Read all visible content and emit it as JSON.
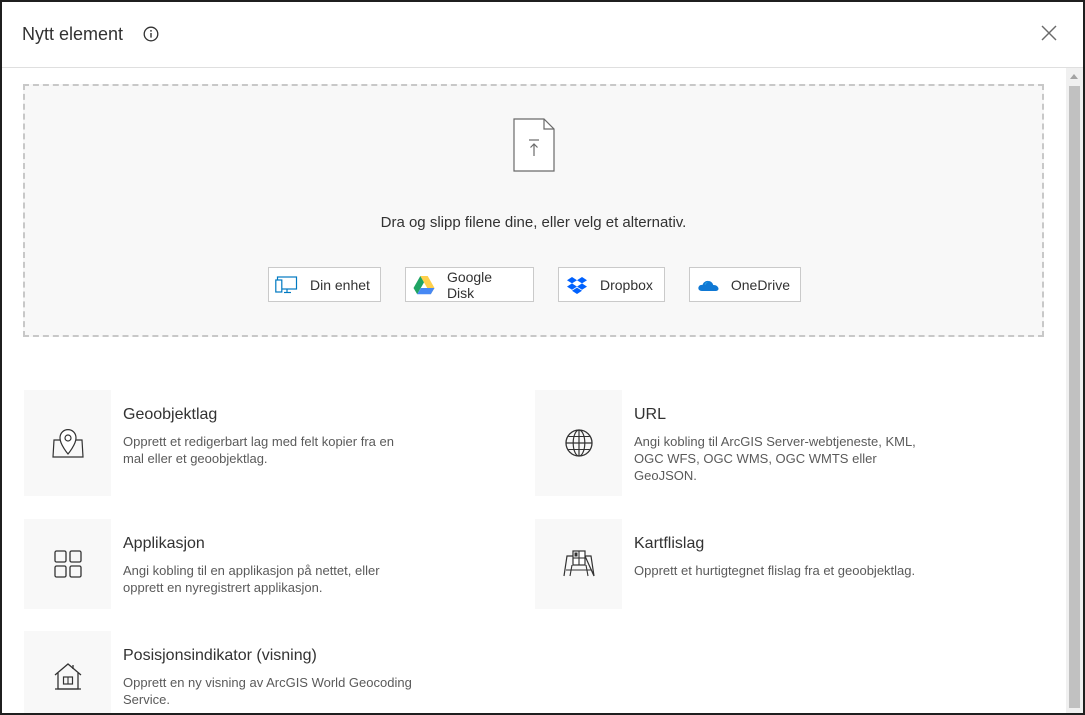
{
  "dialog": {
    "title": "Nytt element"
  },
  "dropzone": {
    "instruction": "Dra og slipp filene dine, eller velg et alternativ.",
    "sources": [
      {
        "label": "Din enhet",
        "icon": "device-icon"
      },
      {
        "label": "Google Disk",
        "icon": "google-drive-icon"
      },
      {
        "label": "Dropbox",
        "icon": "dropbox-icon"
      },
      {
        "label": "OneDrive",
        "icon": "onedrive-icon"
      }
    ]
  },
  "options": [
    {
      "title": "Geoobjektlag",
      "desc": "Opprett et redigerbart lag med felt kopier fra en mal eller et geoobjektlag.",
      "icon": "map-pin-icon"
    },
    {
      "title": "URL",
      "desc": "Angi kobling til ArcGIS Server-webtjeneste, KML, OGC WFS, OGC WMS, OGC WMTS eller GeoJSON.",
      "icon": "globe-icon"
    },
    {
      "title": "Applikasjon",
      "desc": "Angi kobling til en applikasjon på nettet, eller opprett en nyregistrert applikasjon.",
      "icon": "grid-icon"
    },
    {
      "title": "Kartflislag",
      "desc": "Opprett et hurtigtegnet flislag fra et geoobjektlag.",
      "icon": "tile-layer-icon"
    },
    {
      "title": "Posisjonsindikator (visning)",
      "desc": "Opprett en ny visning av ArcGIS World Geocoding Service.",
      "icon": "house-icon"
    }
  ],
  "colors": {
    "google_green": "#1fa463",
    "google_yellow": "#ffd04b",
    "google_blue": "#4688f4",
    "dropbox_blue": "#0061fe",
    "onedrive_blue": "#0f78d4"
  }
}
